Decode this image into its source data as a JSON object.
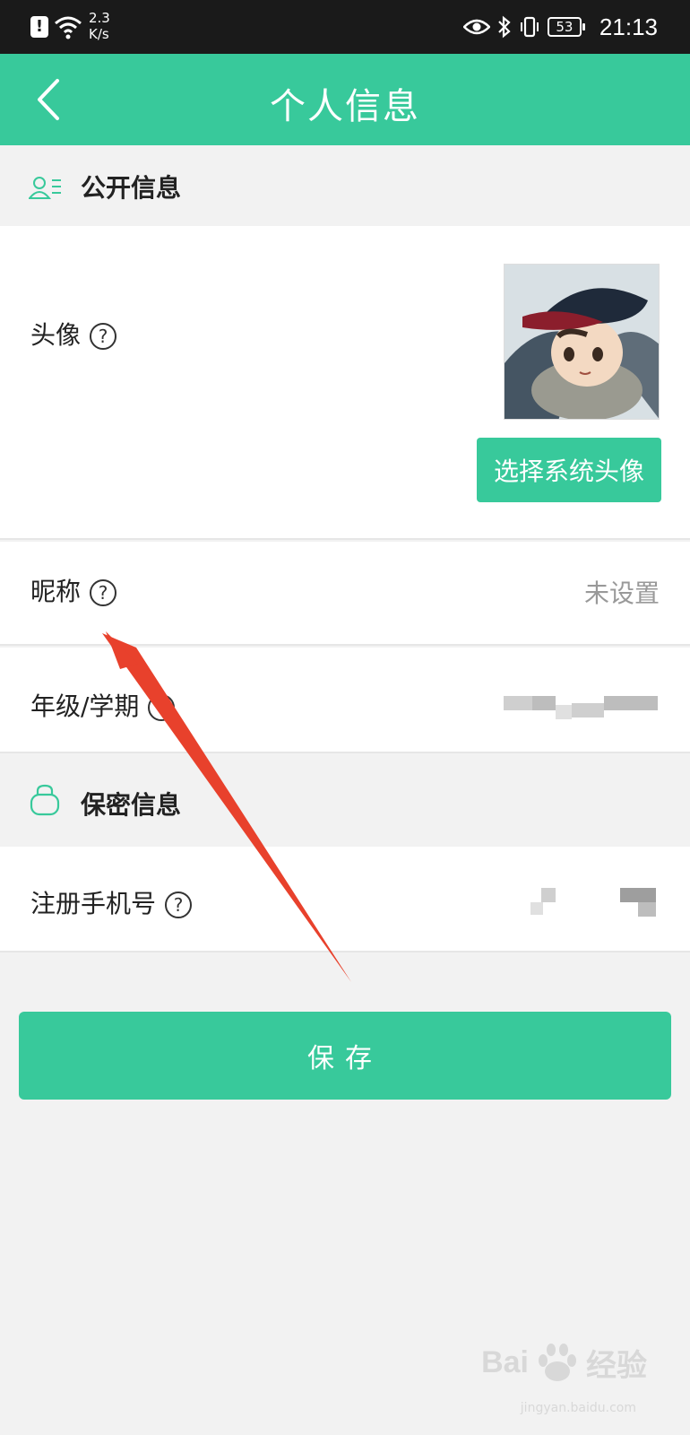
{
  "status_bar": {
    "speed_value": "2.3",
    "speed_unit": "K/s",
    "battery": "53",
    "time": "21:13"
  },
  "header": {
    "title": "个人信息"
  },
  "public_section": {
    "title": "公开信息"
  },
  "avatar_row": {
    "label": "头像",
    "help": "?",
    "choose_button": "选择系统头像"
  },
  "nickname_row": {
    "label": "昵称",
    "help": "?",
    "value": "未设置"
  },
  "grade_row": {
    "label": "年级/学期",
    "help": "?"
  },
  "private_section": {
    "title": "保密信息"
  },
  "phone_row": {
    "label": "注册手机号",
    "help": "?"
  },
  "save_button": "保存",
  "watermark": {
    "brand": "Bai",
    "brand2": "经验",
    "url": "jingyan.baidu.com"
  },
  "colors": {
    "accent": "#38c99b",
    "annotation_arrow": "#e8412c"
  }
}
